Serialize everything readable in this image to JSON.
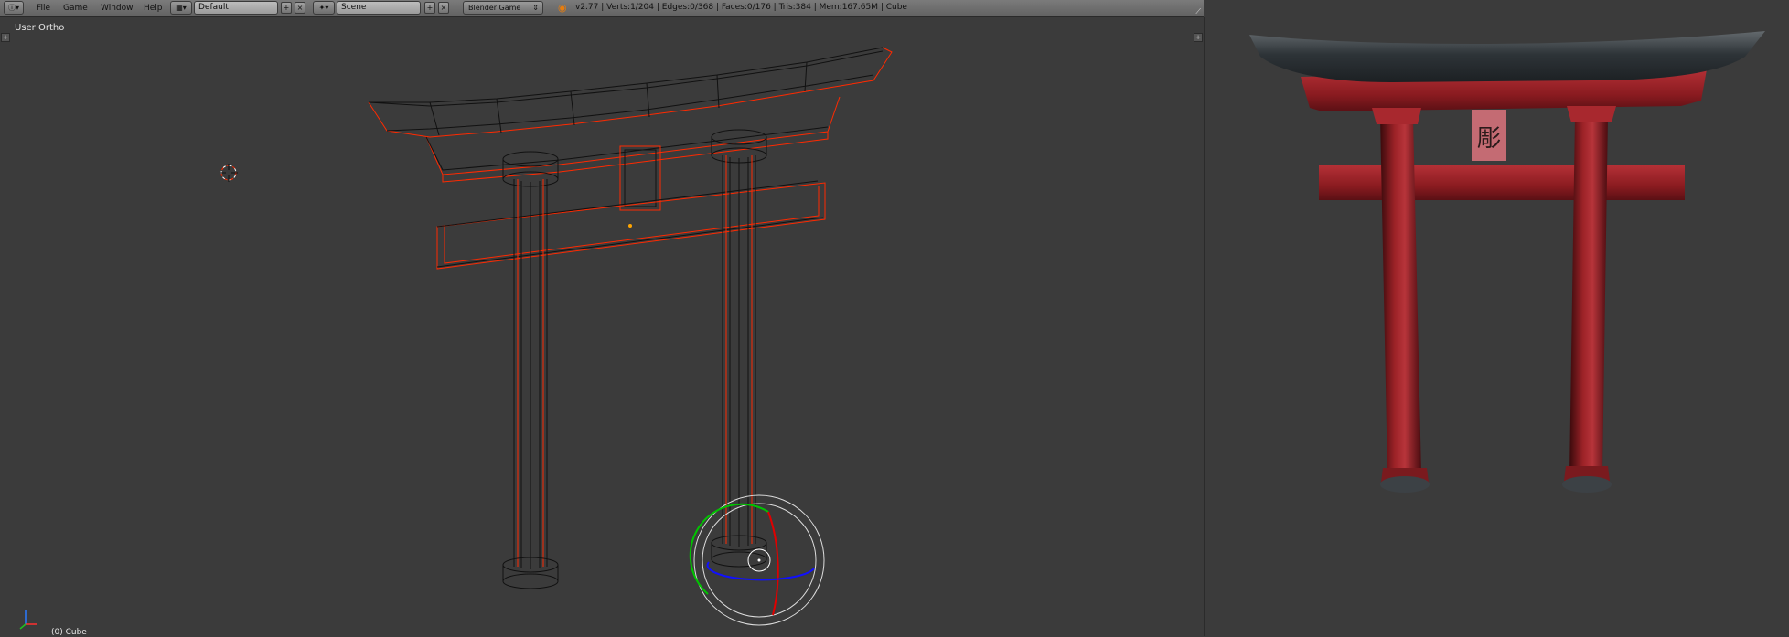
{
  "header": {
    "menus": [
      "File",
      "Game",
      "Window",
      "Help"
    ],
    "layout_name": "Default",
    "scene_name": "Scene",
    "engine": "Blender Game",
    "stats": "v2.77 | Verts:1/204 | Edges:0/368 | Faces:0/176 | Tris:384 | Mem:167.65M | Cube"
  },
  "viewport": {
    "view_label": "User Ortho",
    "object_label": "(0) Cube"
  },
  "render_panel": {
    "plaque_glyph": "彫"
  },
  "colors": {
    "header_bg": "#6e6e6e",
    "viewport_bg": "#3b3b3b",
    "wire": "#111111",
    "selected_wire": "#ff2a00",
    "torii_red": "#8b1a1e",
    "roof_dark": "#2d3236"
  },
  "icons": [
    "info-icon",
    "screen-layout-icon",
    "scene-icon",
    "blender-logo-icon",
    "cursor-icon",
    "manipulator-icon",
    "axis-icon"
  ]
}
